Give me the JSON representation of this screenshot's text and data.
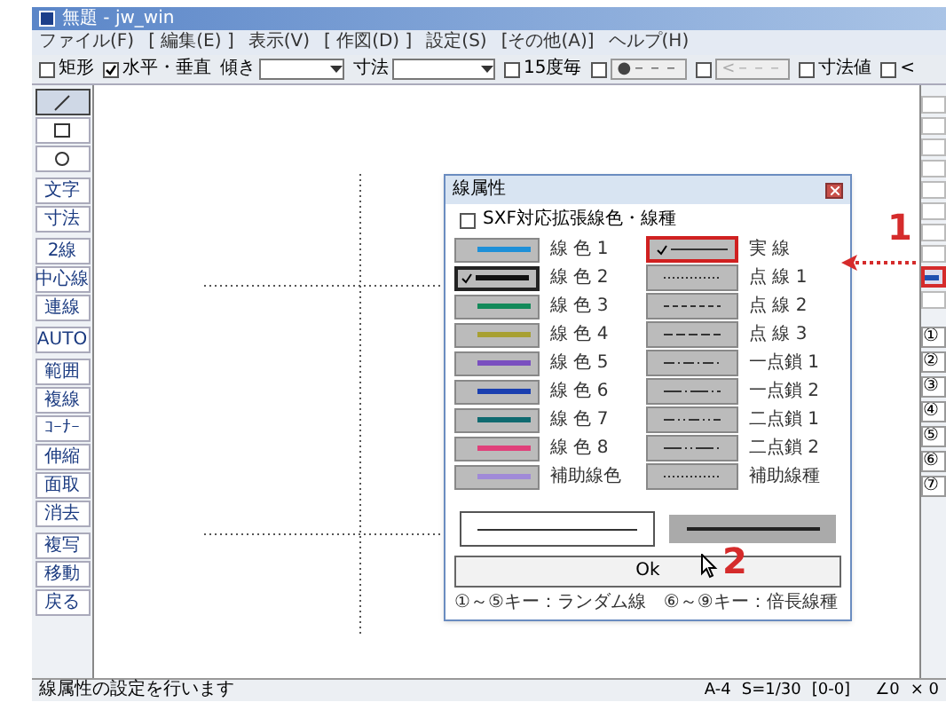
{
  "window": {
    "title": "無題 - jw_win"
  },
  "menu": [
    "ファイル(F)",
    "[ 編集(E) ]",
    "表示(V)",
    "[ 作図(D) ]",
    "設定(S)",
    "[その他(A)]",
    "ヘルプ(H)"
  ],
  "toolbar": [
    {
      "kind": "check",
      "label": "矩形",
      "checked": false
    },
    {
      "kind": "check",
      "label": "水平・垂直",
      "checked": true
    },
    {
      "kind": "select",
      "label": "傾き"
    },
    {
      "kind": "select",
      "label": "寸法"
    },
    {
      "kind": "check",
      "label": "15度毎",
      "checked": false
    },
    {
      "kind": "checkbutton",
      "label": "●－－－",
      "checked": false,
      "disabled": false
    },
    {
      "kind": "checkbutton",
      "label": "<－－－",
      "checked": false,
      "disabled": true
    },
    {
      "kind": "check",
      "label": "寸法値",
      "checked": false
    },
    {
      "kind": "check",
      "label": "<",
      "checked": false
    }
  ],
  "tools": [
    {
      "kind": "line",
      "selected": true
    },
    {
      "kind": "rect",
      "selected": false
    },
    {
      "kind": "circle",
      "selected": false
    },
    {
      "kind": "text",
      "label": "文字",
      "selected": false
    },
    {
      "kind": "text",
      "label": "寸法",
      "selected": false
    },
    {
      "kind": "text",
      "label": "2線",
      "selected": false
    },
    {
      "kind": "text",
      "label": "中心線",
      "selected": false
    },
    {
      "kind": "text",
      "label": "連線",
      "selected": false
    },
    {
      "kind": "text",
      "label": "AUTO",
      "selected": false
    },
    {
      "kind": "text",
      "label": "範囲",
      "selected": false
    },
    {
      "kind": "text",
      "label": "複線",
      "selected": false
    },
    {
      "kind": "text",
      "label": "ｺｰﾅｰ",
      "selected": false
    },
    {
      "kind": "text",
      "label": "伸縮",
      "selected": false
    },
    {
      "kind": "text",
      "label": "面取",
      "selected": false
    },
    {
      "kind": "text",
      "label": "消去",
      "selected": false
    },
    {
      "kind": "text",
      "label": "複写",
      "selected": false
    },
    {
      "kind": "text",
      "label": "移動",
      "selected": false
    },
    {
      "kind": "text",
      "label": "戻る",
      "selected": false
    }
  ],
  "right_toolbar": {
    "layers": [
      "①",
      "②",
      "③",
      "④",
      "⑤",
      "⑥",
      "⑦"
    ]
  },
  "dialog": {
    "title": "線属性",
    "sxf": {
      "label": "SXF対応拡張線色・線種",
      "checked": false
    },
    "colors": [
      {
        "label": "線 色 1",
        "color": "#1e90d8",
        "selected": false
      },
      {
        "label": "線 色 2",
        "color": "#111111",
        "selected": true
      },
      {
        "label": "線 色 3",
        "color": "#138a5a",
        "selected": false
      },
      {
        "label": "線 色 4",
        "color": "#a8a032",
        "selected": false
      },
      {
        "label": "線 色 5",
        "color": "#7a4fc0",
        "selected": false
      },
      {
        "label": "線 色 6",
        "color": "#1a3fb0",
        "selected": false
      },
      {
        "label": "線 色 7",
        "color": "#0f6a70",
        "selected": false
      },
      {
        "label": "線 色 8",
        "color": "#e0407a",
        "selected": false
      },
      {
        "label": "補助線色",
        "color": "#a08ad8",
        "selected": false
      }
    ],
    "line_types": [
      {
        "label": "実 線",
        "kind": "solid",
        "selected": true
      },
      {
        "label": "点 線 1",
        "kind": "dot",
        "selected": false
      },
      {
        "label": "点 線 2",
        "kind": "dash",
        "selected": false
      },
      {
        "label": "点 線 3",
        "kind": "longdash",
        "selected": false
      },
      {
        "label": "一点鎖 1",
        "kind": "chain1",
        "selected": false
      },
      {
        "label": "一点鎖 2",
        "kind": "chain1long",
        "selected": false
      },
      {
        "label": "二点鎖 1",
        "kind": "chain2",
        "selected": false
      },
      {
        "label": "二点鎖 2",
        "kind": "chain2long",
        "selected": false
      },
      {
        "label": "補助線種",
        "kind": "dot",
        "selected": false
      }
    ],
    "ok": "Ok",
    "hint": "①～⑤キー：ランダム線　⑥～⑨キー：倍長線種"
  },
  "annotations": [
    "1",
    "2"
  ],
  "status_bar": {
    "message": "線属性の設定を行います",
    "paper": "A-4",
    "scale": "S=1/30",
    "layer": "[0-0]",
    "angle": "∠0",
    "factor": "× 0"
  }
}
